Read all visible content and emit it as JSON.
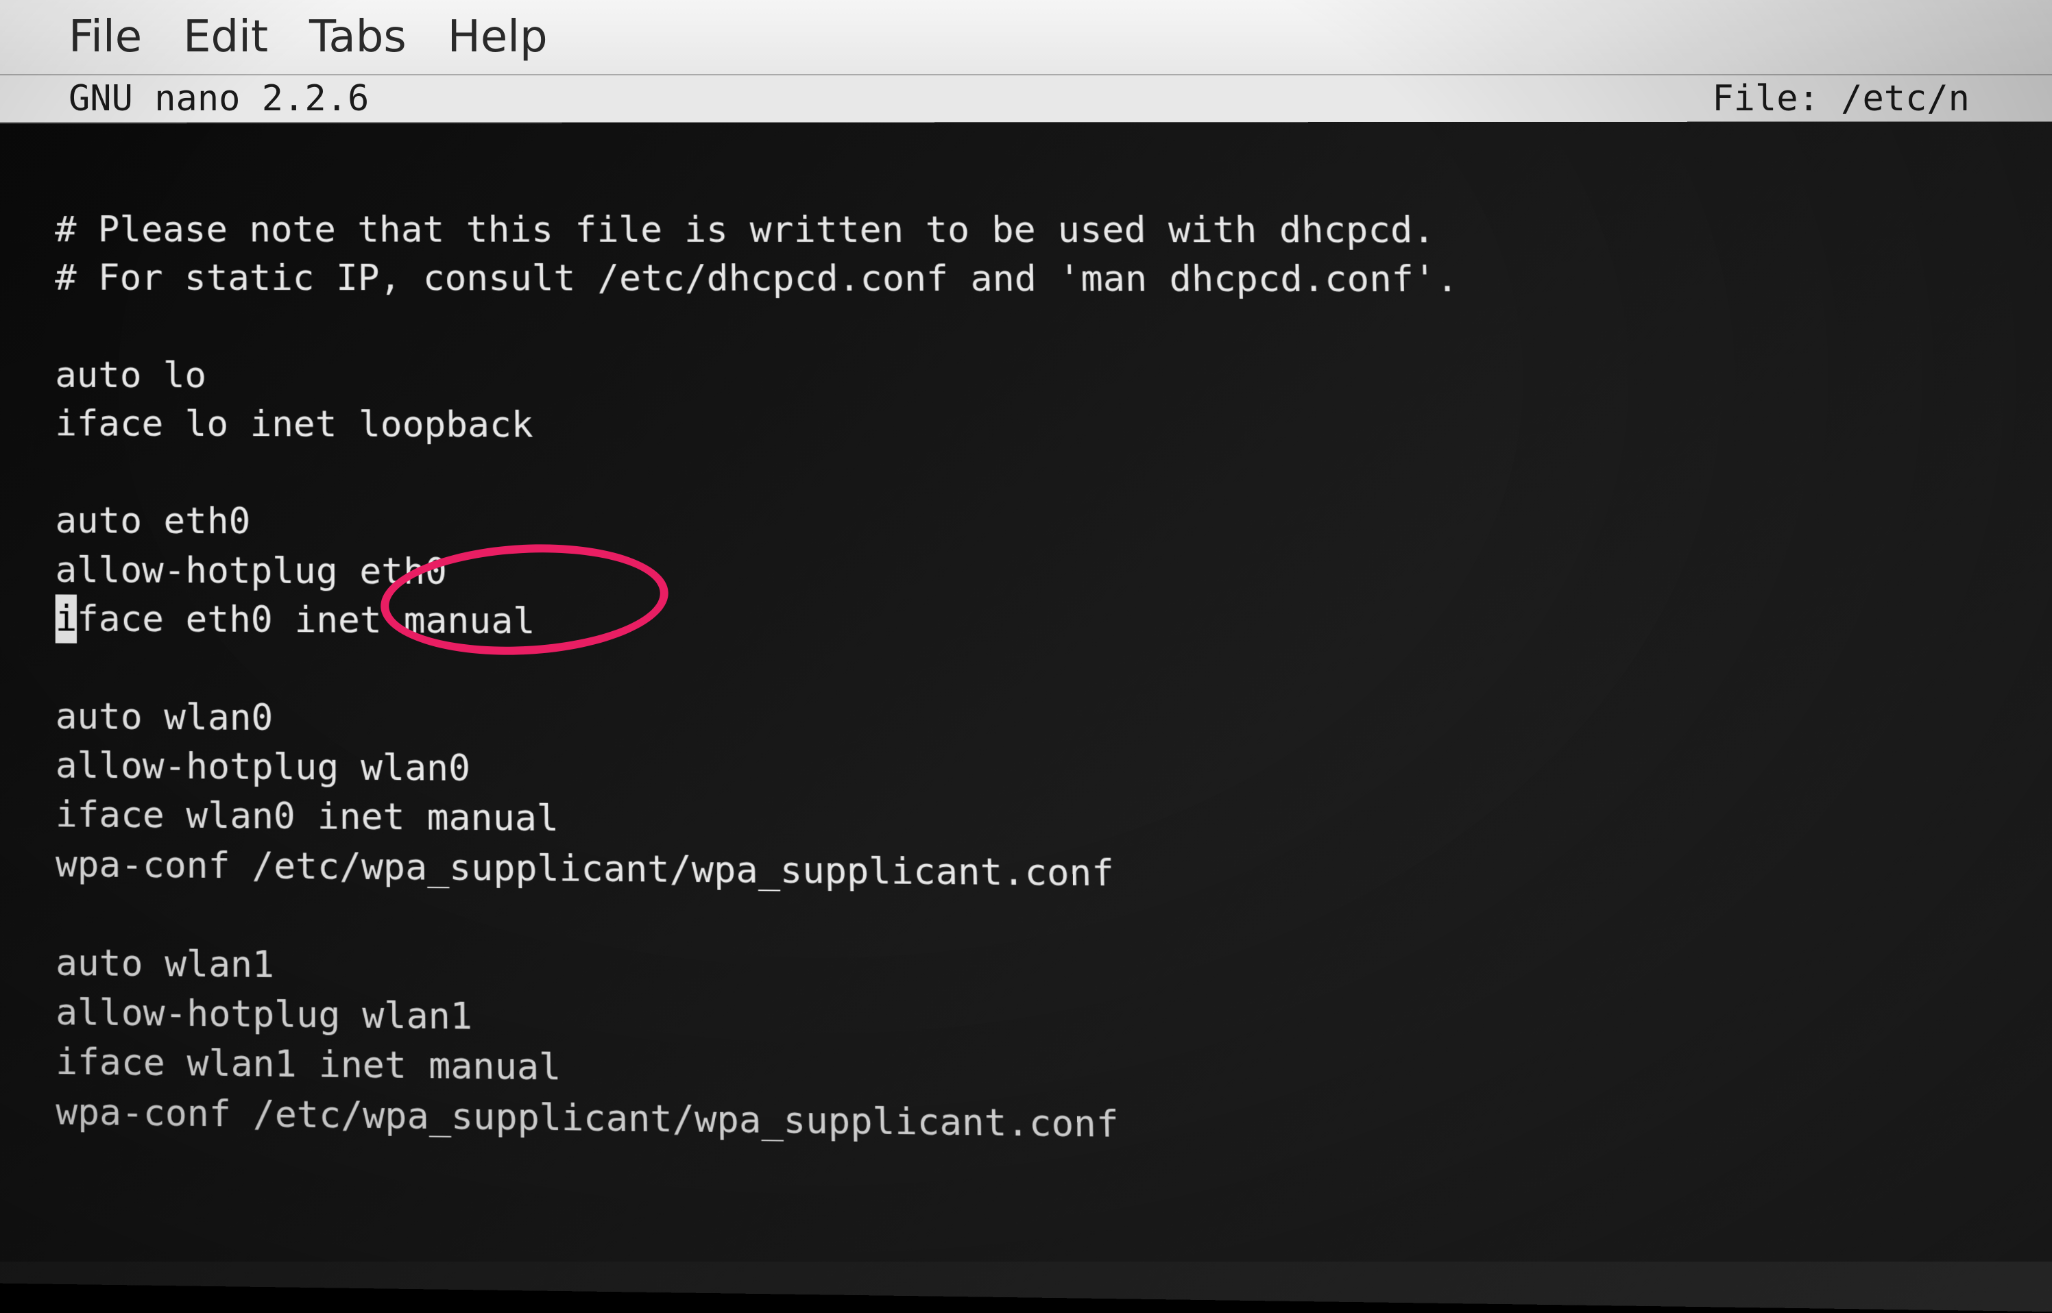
{
  "menubar": {
    "file": "File",
    "edit": "Edit",
    "tabs": "Tabs",
    "help": "Help"
  },
  "titlebar": {
    "left": "  GNU nano 2.2.6",
    "right": "File: /etc/n"
  },
  "editor": {
    "lines": [
      "",
      "# Please note that this file is written to be used with dhcpcd.",
      "# For static IP, consult /etc/dhcpcd.conf and 'man dhcpcd.conf'.",
      "",
      "auto lo",
      "iface lo inet loopback",
      "",
      "auto eth0",
      "allow-hotplug eth0",
      "",
      "",
      "auto wlan0",
      "allow-hotplug wlan0",
      "iface wlan0 inet manual",
      "wpa-conf /etc/wpa_supplicant/wpa_supplicant.conf",
      "",
      "auto wlan1",
      "allow-hotplug wlan1",
      "iface wlan1 inet manual",
      "wpa-conf /etc/wpa_supplicant/wpa_supplicant.conf"
    ],
    "cursor_line_prefix": "",
    "cursor_char": "i",
    "cursor_line_suffix": "face eth0 inet manual"
  },
  "annotation": {
    "circled_text": "inet manual"
  }
}
